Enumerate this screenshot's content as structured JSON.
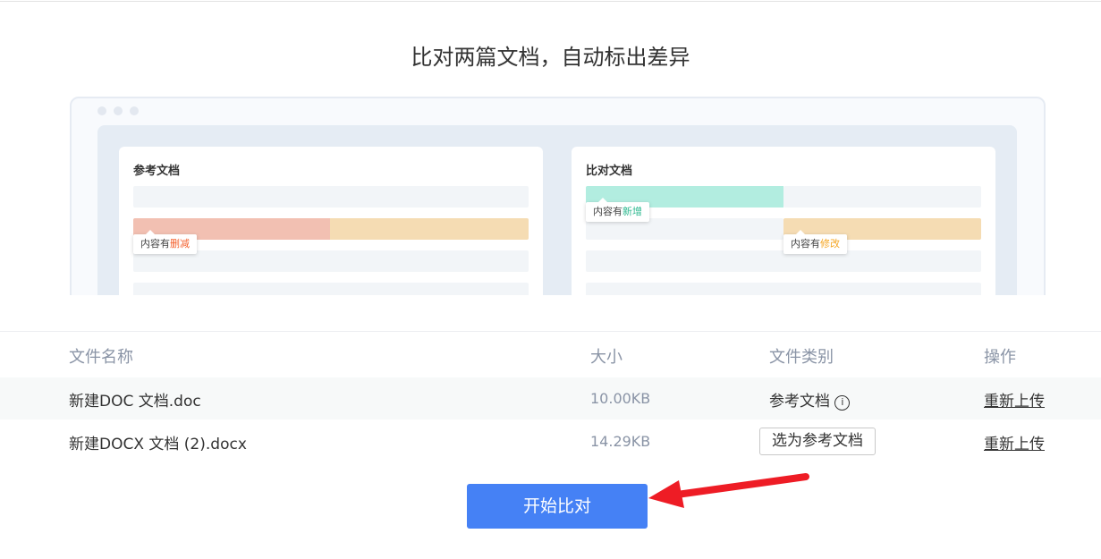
{
  "title": "比对两篇文档，自动标出差异",
  "illustration": {
    "left_card": {
      "title": "参考文档",
      "tooltip_prefix": "内容有",
      "tooltip_highlight": "删减"
    },
    "right_card": {
      "title": "比对文档",
      "tooltip_add_prefix": "内容有",
      "tooltip_add_highlight": "新增",
      "tooltip_mod_prefix": "内容有",
      "tooltip_mod_highlight": "修改"
    },
    "colors": {
      "delete": "#f2c0b2",
      "modify": "#f5dcb3",
      "add": "#b2ede0",
      "delete_text": "#f4612e",
      "add_text": "#2cb88f",
      "modify_text": "#f5a623"
    }
  },
  "table": {
    "headers": [
      "文件名称",
      "大小",
      "文件类别",
      "操作"
    ],
    "rows": [
      {
        "name": "新建DOC 文档.doc",
        "size": "10.00KB",
        "category": "参考文档",
        "action": "重新上传"
      },
      {
        "name": "新建DOCX 文档 (2).docx",
        "size": "14.29KB",
        "category_button": "选为参考文档",
        "action": "重新上传"
      }
    ]
  },
  "start_button": "开始比对",
  "accent": "#4581f5"
}
